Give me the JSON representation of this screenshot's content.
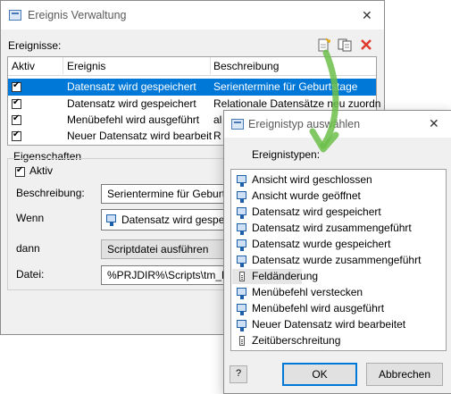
{
  "main_window": {
    "title": "Ereignis Verwaltung",
    "close_glyph": "✕",
    "events_label": "Ereignisse:",
    "toolbar": {
      "new_icon": "new-document-icon",
      "copy_icon": "copy-icon",
      "delete_icon": "delete-icon"
    },
    "table": {
      "headers": [
        "Aktiv",
        "Ereignis",
        "Beschreibung"
      ],
      "rows": [
        {
          "active": true,
          "event": "Datensatz wird gespeichert",
          "description": "Serientermine für Geburtstage"
        },
        {
          "active": true,
          "event": "Datensatz wird gespeichert",
          "description": "Relationale Datensätze neu zuordn"
        },
        {
          "active": true,
          "event": "Menübefehl wird ausgeführt",
          "description": "al"
        },
        {
          "active": true,
          "event": "Neuer Datensatz wird bearbeit",
          "description": "R"
        }
      ]
    },
    "properties": {
      "title": "Eigenschaften",
      "active_label": "Aktiv",
      "description_label": "Beschreibung:",
      "description_value": "Serientermine für Geburt",
      "when_label": "Wenn",
      "when_value": "Datensatz wird gespe",
      "then_label": "dann",
      "then_value": "Scriptdatei ausführen",
      "file_label": "Datei:",
      "file_value": "%PRJDIR%\\Scripts\\tm_B"
    }
  },
  "dialog": {
    "title": "Ereignistyp auswählen",
    "close_glyph": "✕",
    "list_label": "Ereignistypen:",
    "items": [
      {
        "label": "Ansicht wird geschlossen",
        "icon": "monitor"
      },
      {
        "label": "Ansicht wurde geöffnet",
        "icon": "monitor"
      },
      {
        "label": "Datensatz wird gespeichert",
        "icon": "monitor"
      },
      {
        "label": "Datensatz wird zusammengeführt",
        "icon": "monitor"
      },
      {
        "label": "Datensatz wurde gespeichert",
        "icon": "monitor"
      },
      {
        "label": "Datensatz wurde zusammengeführt",
        "icon": "monitor"
      },
      {
        "label": "Feldänderung",
        "icon": "field"
      },
      {
        "label": "Menübefehl verstecken",
        "icon": "monitor"
      },
      {
        "label": "Menübefehl wird ausgeführt",
        "icon": "monitor"
      },
      {
        "label": "Neuer Datensatz wird bearbeitet",
        "icon": "monitor"
      },
      {
        "label": "Zeitüberschreitung",
        "icon": "field"
      }
    ],
    "help_glyph": "?",
    "ok_label": "OK",
    "cancel_label": "Abbrechen"
  },
  "colors": {
    "selection": "#0078d7",
    "arrow": "#6cc04a",
    "delete": "#e03a2f"
  }
}
